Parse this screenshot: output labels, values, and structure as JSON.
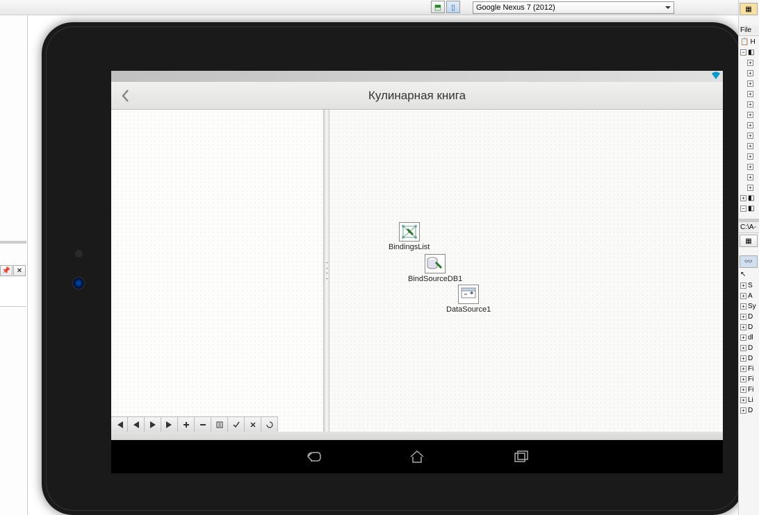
{
  "toolbar": {
    "device_selected": "Google Nexus 7 (2012)"
  },
  "app": {
    "title": "Кулинарная книга"
  },
  "components": {
    "bindings_list": "BindingsList",
    "bind_source_db": "BindSourceDB1",
    "data_source": "DataSource1"
  },
  "right_sidebar": {
    "file_header": "File",
    "path_label": "C:\\A-",
    "model_items": [
      "H"
    ],
    "class_items": [
      "S",
      "A",
      "Sy",
      "D",
      "D",
      "dl",
      "D",
      "D",
      "Fi",
      "Fi",
      "Fi",
      "Li",
      "D"
    ]
  }
}
